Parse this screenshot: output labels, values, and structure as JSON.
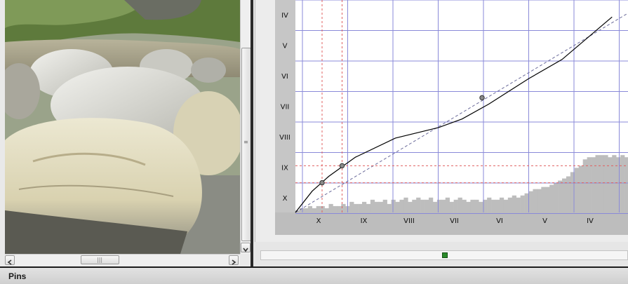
{
  "panels": {
    "pins_label": "Pins"
  },
  "photo": {
    "description_icon": "rock-photo"
  },
  "curve_editor": {
    "y_zone_labels": [
      "IV",
      "V",
      "VI",
      "VII",
      "VIII",
      "IX",
      "X"
    ],
    "x_zone_labels": [
      "X",
      "IX",
      "VIII",
      "VII",
      "VI",
      "V",
      "IV"
    ],
    "colors": {
      "grid": "#8a8ad8",
      "pin_guides": "#e06060",
      "curve": "#000000",
      "histogram": "#bdbdbd"
    }
  },
  "chart_data": {
    "type": "line",
    "title": "",
    "xlabel": "",
    "ylabel": "",
    "x_tick_labels": [
      "X",
      "IX",
      "VIII",
      "VII",
      "VI",
      "V",
      "IV"
    ],
    "y_tick_labels": [
      "IV",
      "V",
      "VI",
      "VII",
      "VIII",
      "IX",
      "X"
    ],
    "xlim": [
      0,
      1
    ],
    "ylim": [
      0,
      1
    ],
    "grid": true,
    "series": [
      {
        "x": [
          0.0,
          0.05,
          0.1,
          0.18,
          0.3,
          0.43,
          0.5,
          0.58,
          0.7,
          0.8,
          0.95
        ],
        "y": [
          0.0,
          0.1,
          0.17,
          0.26,
          0.35,
          0.4,
          0.44,
          0.51,
          0.63,
          0.72,
          0.92
        ]
      }
    ],
    "reference_line": {
      "x": [
        0,
        1
      ],
      "y": [
        0,
        0.94
      ]
    },
    "pins": [
      {
        "x": 0.08,
        "y": 0.14
      },
      {
        "x": 0.14,
        "y": 0.22
      },
      {
        "x": 0.56,
        "y": 0.54
      }
    ],
    "histogram": {
      "bins": 80,
      "values": [
        0.01,
        0.02,
        0.02,
        0.03,
        0.02,
        0.03,
        0.03,
        0.02,
        0.04,
        0.03,
        0.03,
        0.04,
        0.03,
        0.05,
        0.04,
        0.04,
        0.05,
        0.04,
        0.06,
        0.05,
        0.05,
        0.06,
        0.04,
        0.06,
        0.05,
        0.06,
        0.07,
        0.05,
        0.06,
        0.07,
        0.06,
        0.06,
        0.07,
        0.05,
        0.06,
        0.06,
        0.07,
        0.05,
        0.06,
        0.07,
        0.06,
        0.05,
        0.06,
        0.06,
        0.05,
        0.06,
        0.07,
        0.06,
        0.06,
        0.07,
        0.06,
        0.07,
        0.08,
        0.07,
        0.08,
        0.09,
        0.1,
        0.11,
        0.11,
        0.12,
        0.12,
        0.13,
        0.14,
        0.15,
        0.16,
        0.17,
        0.19,
        0.21,
        0.22,
        0.25,
        0.26,
        0.26,
        0.27,
        0.27,
        0.27,
        0.26,
        0.27,
        0.26,
        0.27,
        0.26
      ]
    }
  }
}
